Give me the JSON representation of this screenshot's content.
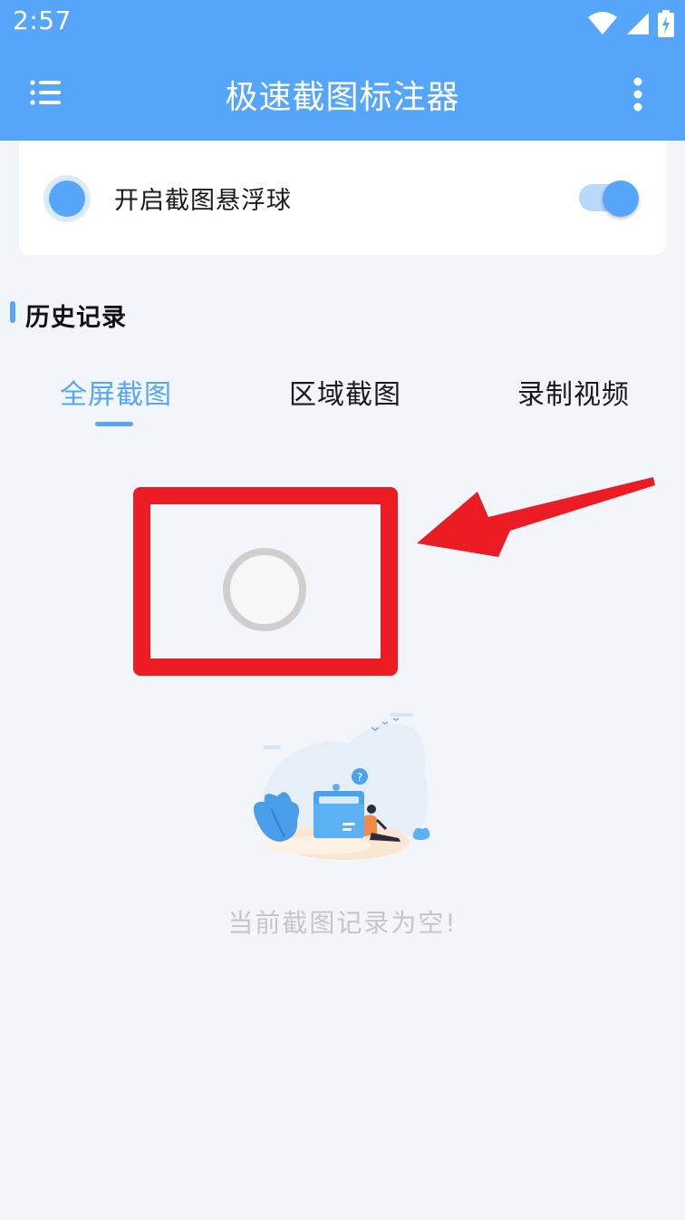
{
  "status_bar": {
    "time": "2:57",
    "icons": [
      "wifi-icon",
      "signal-icon",
      "battery-charging-icon"
    ]
  },
  "app_bar": {
    "title": "极速截图标注器",
    "menu_icon": "list-menu-icon",
    "more_icon": "more-vertical-icon"
  },
  "floating_ball": {
    "label": "开启截图悬浮球",
    "enabled": true
  },
  "history": {
    "title": "历史记录",
    "tabs": [
      {
        "label": "全屏截图",
        "active": true
      },
      {
        "label": "区域截图",
        "active": false
      },
      {
        "label": "录制视频",
        "active": false
      }
    ],
    "empty_message": "当前截图记录为空!"
  },
  "colors": {
    "primary": "#55a6fb",
    "background": "#f2f6fa",
    "annotation_red": "#ec1c24",
    "muted_text": "#c3c7cc"
  }
}
